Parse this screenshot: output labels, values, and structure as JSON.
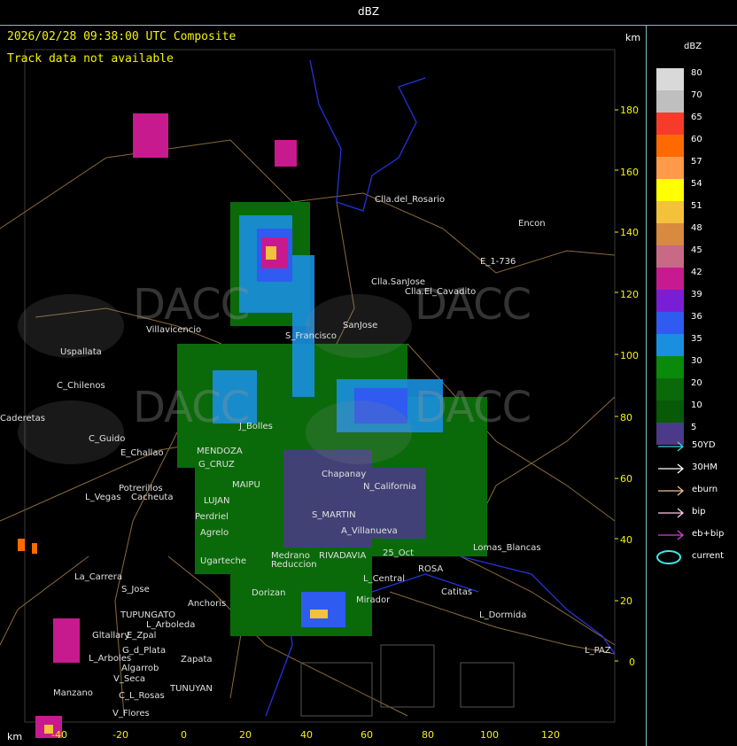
{
  "title": "dBZ",
  "header": {
    "timestamp": "2026/02/28 09:38:00 UTC Composite",
    "track_status": "Track data not available",
    "km_top": "km",
    "km_bottom": "km"
  },
  "watermark": "DACC",
  "y_ticks": [
    "180",
    "160",
    "140",
    "120",
    "100",
    "80",
    "60",
    "40",
    "20",
    "0"
  ],
  "x_ticks": [
    "-40",
    "-20",
    "0",
    "20",
    "40",
    "60",
    "80",
    "100",
    "120"
  ],
  "legend": {
    "title": "dBZ",
    "levels": [
      {
        "value": "80",
        "color": "#d9d9d9"
      },
      {
        "value": "70",
        "color": "#bfbfbf"
      },
      {
        "value": "65",
        "color": "#f63b2b"
      },
      {
        "value": "60",
        "color": "#ff6a00"
      },
      {
        "value": "57",
        "color": "#ff9a4a"
      },
      {
        "value": "54",
        "color": "#ffff00"
      },
      {
        "value": "51",
        "color": "#f3c13a"
      },
      {
        "value": "48",
        "color": "#d88a3e"
      },
      {
        "value": "45",
        "color": "#c86a85"
      },
      {
        "value": "42",
        "color": "#c81a8f"
      },
      {
        "value": "39",
        "color": "#7a1ed6"
      },
      {
        "value": "36",
        "color": "#2f5bf0"
      },
      {
        "value": "35",
        "color": "#1a8fe0"
      },
      {
        "value": "30",
        "color": "#0a8a0a"
      },
      {
        "value": "20",
        "color": "#0a6a0a"
      },
      {
        "value": "10",
        "color": "#075a07"
      },
      {
        "value": "5",
        "color": "#4b3a8a"
      }
    ],
    "tracks": [
      {
        "label": "50YD",
        "color": "#3fd6d6"
      },
      {
        "label": "30HM",
        "color": "#ffffff"
      },
      {
        "label": "eburn",
        "color": "#f5c08a"
      },
      {
        "label": "bip",
        "color": "#ffc8e6"
      },
      {
        "label": "eb+bip",
        "color": "#d63fd6"
      },
      {
        "label": "current",
        "color": "#3fe6e6"
      }
    ]
  },
  "places": [
    "Clla.del_Rosario",
    "Encon",
    "E_1-736",
    "Clla.SanJose",
    "Clla.El_Cavadito",
    "SanJose",
    "Villavicencio",
    "Uspallata",
    "C_Chilenos",
    "Caderetas",
    "C_Guido",
    "E_Challao",
    "MENDOZA",
    "G_CRUZ",
    "LUJAN",
    "MAIPU",
    "L_Vegas",
    "Potrerillos",
    "Cacheuta",
    "Perdriel",
    "Agrelo",
    "Ugarteche",
    "Chapanay",
    "J_Bolles",
    "N_California",
    "S_MARTIN",
    "A_Villanueva",
    "RIVADAVIA",
    "25_Oct",
    "Lomas_Blancas",
    "ROSA",
    "Catitas",
    "L_Dormida",
    "L_PAZ",
    "La_Carrera",
    "S_Jose",
    "TUPUNGATO",
    "E_Zpal",
    "Anchoris",
    "L_Arboleda",
    "Gltallary",
    "G_d_Plata",
    "L_Arboles",
    "Zapata",
    "Algarrob",
    "V_Seca",
    "C_L_Rosas",
    "TUNUYAN",
    "V_Flores",
    "Manzano",
    "S_Francisco",
    "Reduccion",
    "Medrano",
    "Mirador",
    "L_Central",
    "Dorizan"
  ]
}
